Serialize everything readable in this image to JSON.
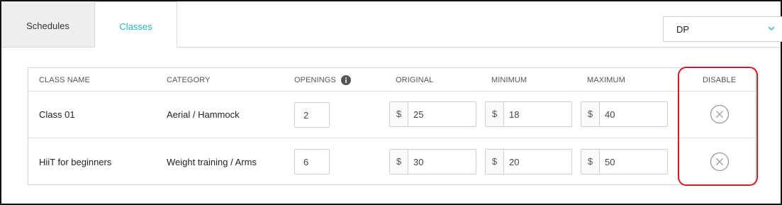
{
  "tabs": {
    "schedules": "Schedules",
    "classes": "Classes"
  },
  "selector": {
    "value": "DP"
  },
  "table": {
    "headers": {
      "class_name": "CLASS NAME",
      "category": "CATEGORY",
      "openings": "OPENINGS",
      "original": "ORIGINAL",
      "minimum": "MINIMUM",
      "maximum": "MAXIMUM",
      "disable": "DISABLE"
    },
    "currency": "$",
    "rows": [
      {
        "class_name": "Class 01",
        "category": "Aerial / Hammock",
        "openings": "2",
        "original": "25",
        "minimum": "18",
        "maximum": "40"
      },
      {
        "class_name": "HiiT for beginners",
        "category": "Weight training / Arms",
        "openings": "6",
        "original": "30",
        "minimum": "20",
        "maximum": "50"
      }
    ]
  },
  "colors": {
    "accent": "#2ab0c0",
    "highlight": "#d9181f",
    "tab_inactive_bg": "#eeeeee"
  },
  "icons": {
    "info": "info-icon",
    "disable": "close-circle-icon",
    "dropdown": "chevron-down-icon"
  }
}
